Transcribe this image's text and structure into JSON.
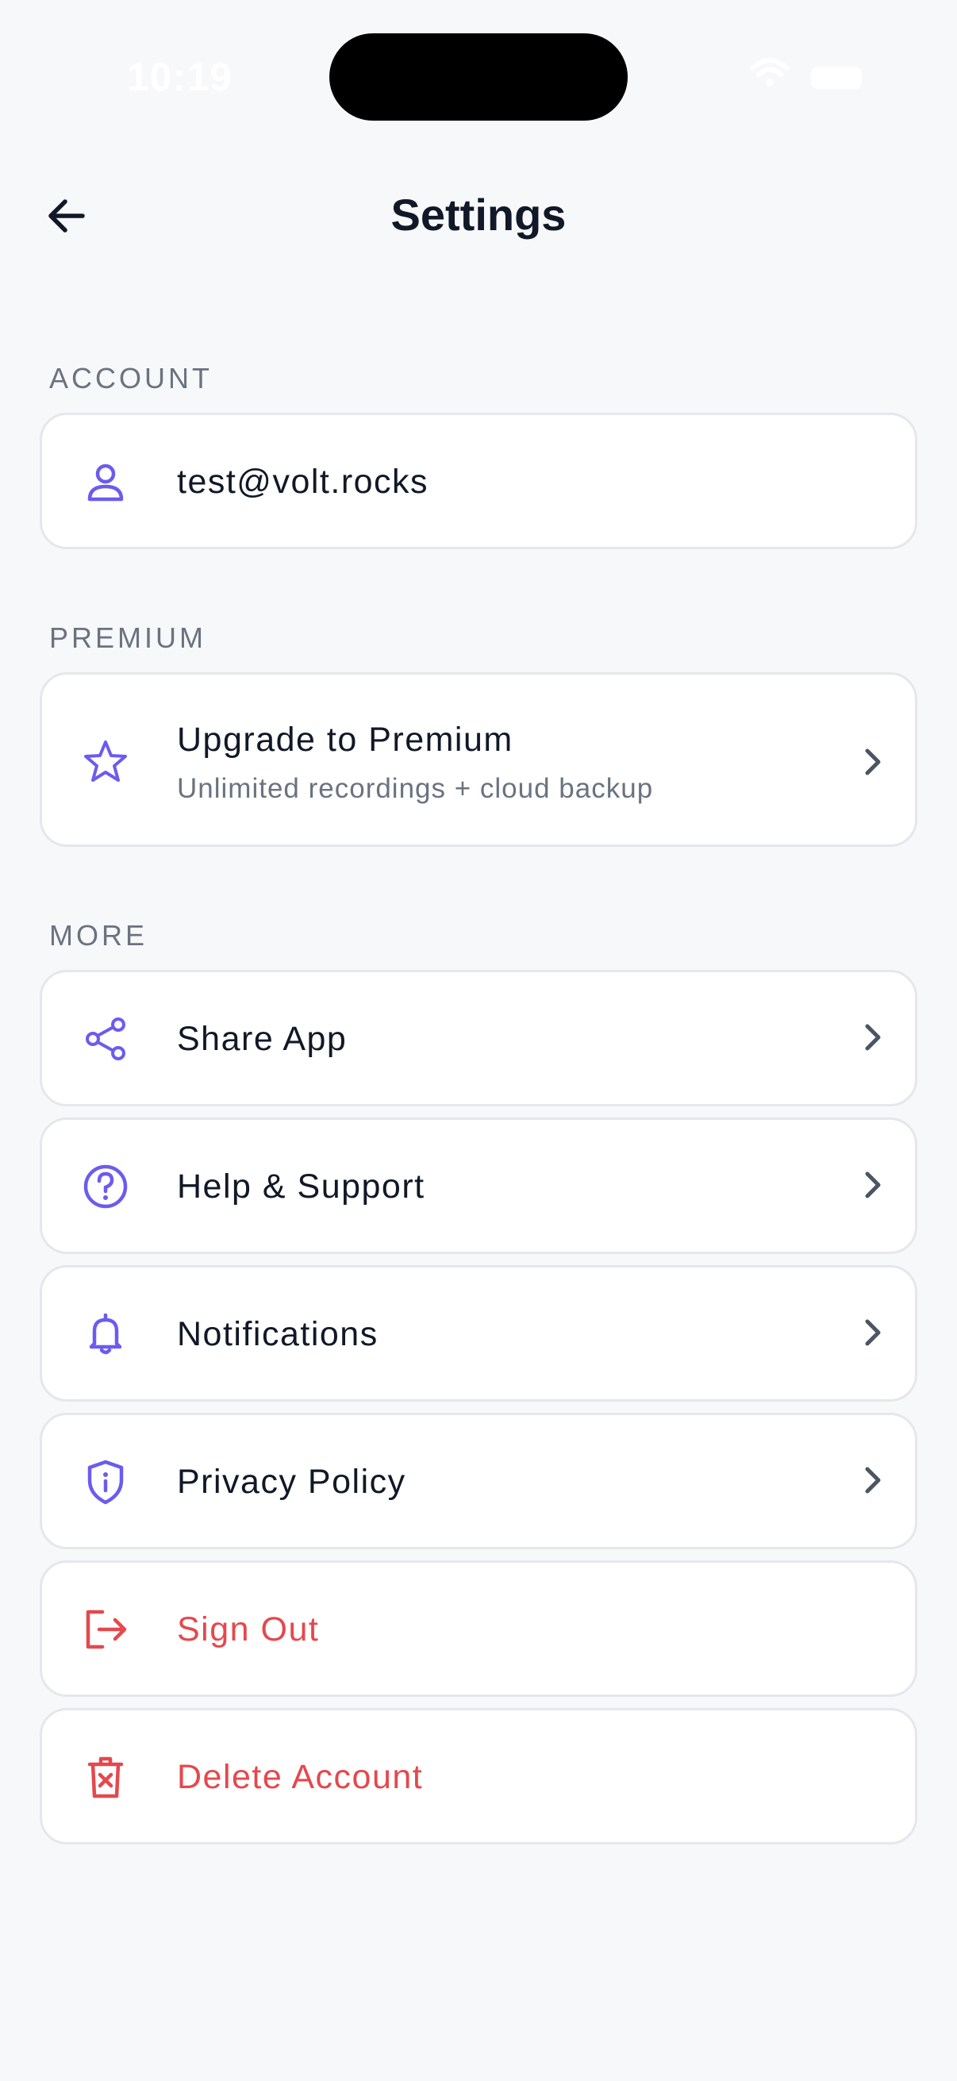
{
  "status_bar": {
    "time": "10:19"
  },
  "header": {
    "title": "Settings",
    "back_icon": "arrow-left-icon"
  },
  "sections": {
    "account": {
      "label": "ACCOUNT",
      "email": "test@volt.rocks",
      "icon": "user-icon"
    },
    "premium": {
      "label": "PREMIUM",
      "title": "Upgrade to Premium",
      "subtitle": "Unlimited recordings + cloud backup",
      "icon": "star-icon"
    },
    "more": {
      "label": "MORE",
      "items": [
        {
          "label": "Share App",
          "icon": "share-icon"
        },
        {
          "label": "Help & Support",
          "icon": "help-circle-icon"
        },
        {
          "label": "Notifications",
          "icon": "bell-icon"
        },
        {
          "label": "Privacy Policy",
          "icon": "shield-info-icon"
        },
        {
          "label": "Sign Out",
          "icon": "sign-out-icon"
        },
        {
          "label": "Delete Account",
          "icon": "trash-icon"
        }
      ]
    }
  },
  "colors": {
    "accent": "#6b5bf0",
    "danger": "#e5484d",
    "background": "#f7f8fa"
  }
}
